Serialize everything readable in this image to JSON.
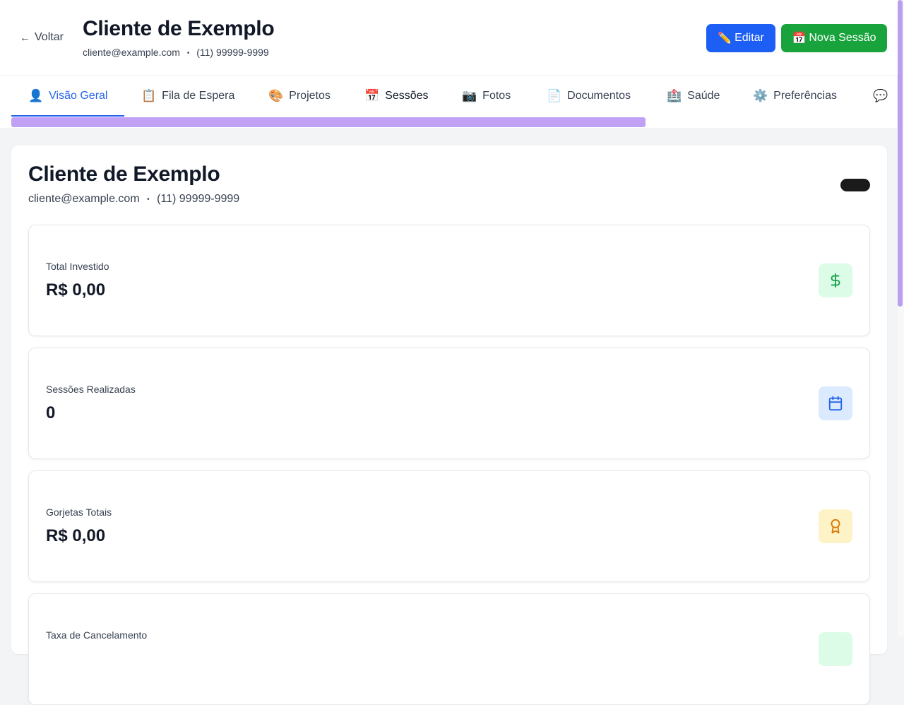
{
  "header": {
    "back_label": "Voltar",
    "client_name": "Cliente de Exemplo",
    "email": "cliente@example.com",
    "phone": "(11) 99999-9999",
    "separator": "•",
    "edit_button": {
      "icon": "✏️",
      "label": "Editar"
    },
    "new_session_button": {
      "icon": "📅",
      "label": "Nova Sessão"
    }
  },
  "tabs": [
    {
      "icon": "👤",
      "label": "Visão Geral",
      "active": true
    },
    {
      "icon": "📋",
      "label": "Fila de Espera"
    },
    {
      "icon": "🎨",
      "label": "Projetos"
    },
    {
      "icon": "📅",
      "label": "Sessões"
    },
    {
      "icon": "📷",
      "label": "Fotos"
    },
    {
      "icon": "📄",
      "label": "Documentos"
    },
    {
      "icon": "🏥",
      "label": "Saúde"
    },
    {
      "icon": "⚙️",
      "label": "Preferências"
    },
    {
      "icon": "💬",
      "label": ""
    }
  ],
  "panel": {
    "client_name": "Cliente de Exemplo",
    "email": "cliente@example.com",
    "phone": "(11) 99999-9999"
  },
  "stats": [
    {
      "label": "Total Investido",
      "value": "R$ 0,00",
      "icon": "dollar-icon",
      "bg": "#dcfce7",
      "fg": "#16a34a"
    },
    {
      "label": "Sessões Realizadas",
      "value": "0",
      "icon": "calendar-icon",
      "bg": "#dbeafe",
      "fg": "#2563eb"
    },
    {
      "label": "Gorjetas Totais",
      "value": "R$ 0,00",
      "icon": "award-icon",
      "bg": "#fef3c7",
      "fg": "#d97706"
    },
    {
      "label": "Taxa de Cancelamento",
      "value": "",
      "icon": "stat-icon",
      "bg": "#dcfce7",
      "fg": "#16a34a"
    }
  ],
  "colors": {
    "primary_blue": "#1d5ff5",
    "primary_green": "#18a33d",
    "tab_active": "#2563eb",
    "scroll_purple": "#c0a1f5"
  }
}
